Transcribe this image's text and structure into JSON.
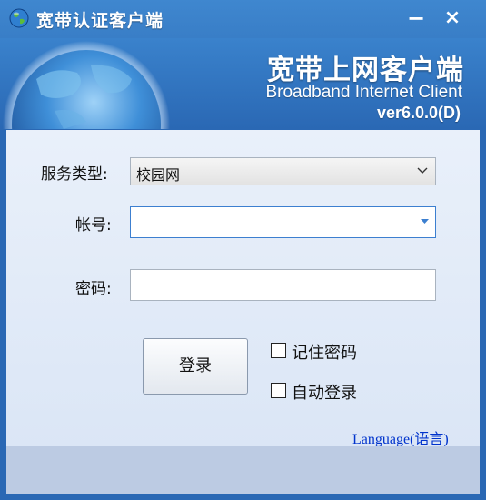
{
  "window": {
    "title": "宽带认证客户端",
    "minimize_glyph": "−",
    "close_glyph": "×"
  },
  "banner": {
    "name_cn": "宽带上网客户端",
    "name_en": "Broadband Internet Client",
    "version": "ver6.0.0(D)"
  },
  "form": {
    "service_type_label": "服务类型:",
    "service_type_value": "校园网",
    "account_label": "帐号:",
    "account_value": "",
    "password_label": "密码:",
    "password_value": ""
  },
  "actions": {
    "login_label": "登录",
    "remember_password_label": "记住密码",
    "auto_login_label": "自动登录",
    "remember_password_checked": false,
    "auto_login_checked": false,
    "language_link": "Language(语言)"
  },
  "icons": {
    "app": "globe-icon",
    "select_arrow": "chevron-down-icon",
    "combo_arrow": "caret-down-icon"
  }
}
